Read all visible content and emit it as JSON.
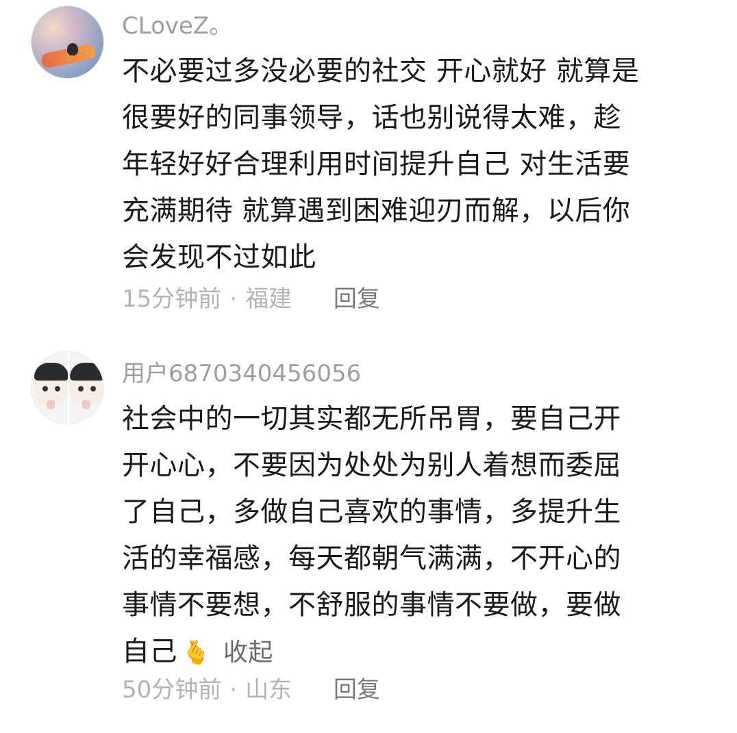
{
  "comments": [
    {
      "username": "CLoveZ。",
      "lines": [
        "不必要过多没必要的社交 开心就好 就算是",
        "很要好的同事领导，话也别说得太难，趁",
        "年轻好好合理利用时间提升自己 对生活要",
        "充满期待 就算遇到困难迎刃而解，以后你",
        "会发现不过如此"
      ],
      "time": "15分钟前",
      "separator": "·",
      "location": "福建",
      "reply_label": "回复"
    },
    {
      "username": "用户6870340456056",
      "lines": [
        "社会中的一切其实都无所吊胃，要自己开",
        "开心心，不要因为处处为别人着想而委屈",
        "了自己，多做自己喜欢的事情，多提升生",
        "活的幸福感，每天都朝气满满，不开心的",
        "事情不要想，不舒服的事情不要做，要做",
        "自己"
      ],
      "emoji": "🫰",
      "emoji_name": "finger-heart-emoji",
      "collapse_label": "收起",
      "time": "50分钟前",
      "separator": "·",
      "location": "山东",
      "reply_label": "回复"
    }
  ],
  "colors": {
    "username": "#9e9e9e",
    "body": "#1a1a1a",
    "meta": "#b3b3b3",
    "reply": "#7a7a7a",
    "background": "#ffffff"
  }
}
